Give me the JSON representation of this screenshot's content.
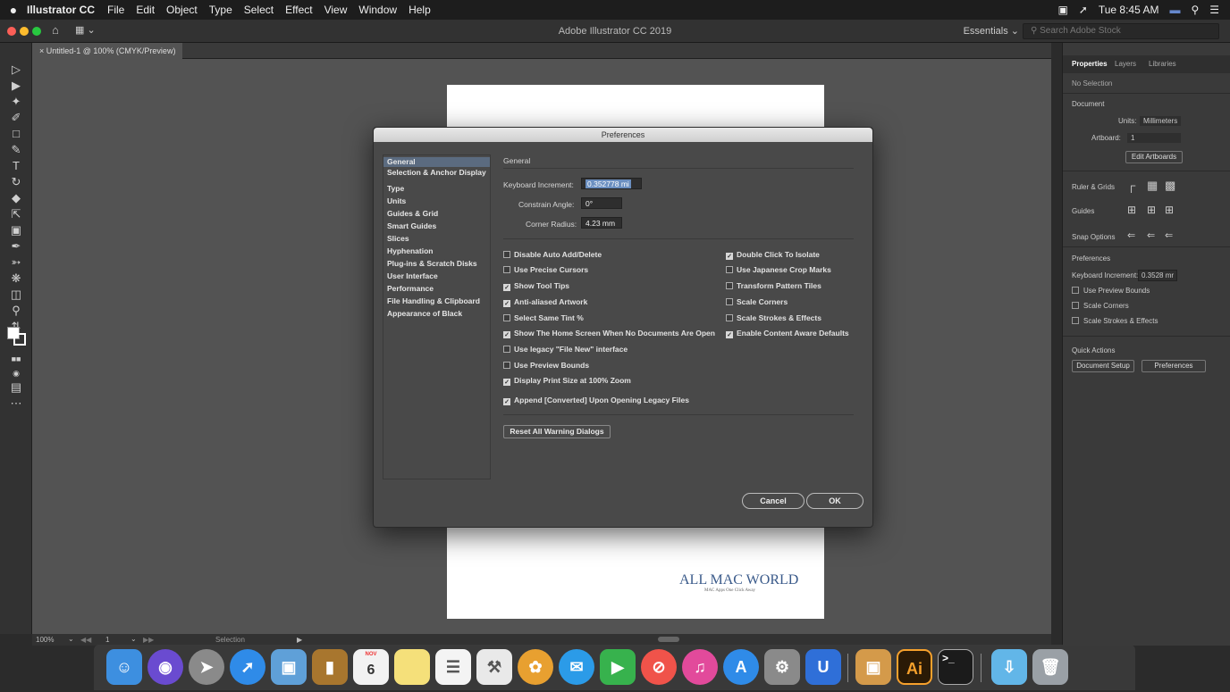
{
  "menubar": {
    "apple": "",
    "app_name": "Illustrator CC",
    "menus": [
      "File",
      "Edit",
      "Object",
      "Type",
      "Select",
      "Effect",
      "View",
      "Window",
      "Help"
    ],
    "clock": "Tue 8:45 AM"
  },
  "titlebar": {
    "title": "Adobe Illustrator CC 2019",
    "workspace": "Essentials ⌄",
    "search_placeholder": "Search Adobe Stock"
  },
  "document": {
    "tab_label": "× Untitled-1 @ 100% (CMYK/Preview)"
  },
  "statusbar": {
    "zoom": "100%",
    "artboard": "1",
    "tool": "Selection"
  },
  "watermark": {
    "title": "ALL MAC WORLD",
    "subtitle": "MAC Apps One Click Away"
  },
  "properties": {
    "tabs": [
      "Properties",
      "Layers",
      "Libraries"
    ],
    "no_selection": "No Selection",
    "document_heading": "Document",
    "units_label": "Units:",
    "units_value": "Millimeters",
    "artboard_label": "Artboard:",
    "artboard_value": "1",
    "edit_artboards": "Edit Artboards",
    "ruler_grids": "Ruler & Grids",
    "guides": "Guides",
    "snap_options": "Snap Options",
    "preferences_heading": "Preferences",
    "keyboard_increment_label": "Keyboard Increment:",
    "keyboard_increment_value": "0.3528 mr",
    "use_preview_bounds": "Use Preview Bounds",
    "scale_corners": "Scale Corners",
    "scale_strokes": "Scale Strokes & Effects",
    "quick_actions": "Quick Actions",
    "document_setup": "Document Setup",
    "preferences_button": "Preferences"
  },
  "dialog": {
    "title": "Preferences",
    "categories": [
      "General",
      "Selection & Anchor Display",
      "Type",
      "Units",
      "Guides & Grid",
      "Smart Guides",
      "Slices",
      "Hyphenation",
      "Plug-ins & Scratch Disks",
      "User Interface",
      "Performance",
      "File Handling & Clipboard",
      "Appearance of Black"
    ],
    "section_title": "General",
    "keyboard_increment_label": "Keyboard Increment:",
    "keyboard_increment_value": "0.352778 mi",
    "constrain_angle_label": "Constrain Angle:",
    "constrain_angle_value": "0°",
    "corner_radius_label": "Corner Radius:",
    "corner_radius_value": "4.23 mm",
    "left_options": [
      {
        "label": "Disable Auto Add/Delete",
        "checked": false
      },
      {
        "label": "Use Precise Cursors",
        "checked": false
      },
      {
        "label": "Show Tool Tips",
        "checked": true
      },
      {
        "label": "Anti-aliased Artwork",
        "checked": true
      },
      {
        "label": "Select Same Tint %",
        "checked": false
      },
      {
        "label": "Show The Home Screen When No Documents Are Open",
        "checked": true
      },
      {
        "label": "Use legacy \"File New\" interface",
        "checked": false
      },
      {
        "label": "Use Preview Bounds",
        "checked": false
      },
      {
        "label": "Display Print Size at 100% Zoom",
        "checked": true
      },
      {
        "label": "Append [Converted] Upon Opening Legacy Files",
        "checked": true
      }
    ],
    "right_options": [
      {
        "label": "Double Click To Isolate",
        "checked": true
      },
      {
        "label": "Use Japanese Crop Marks",
        "checked": false
      },
      {
        "label": "Transform Pattern Tiles",
        "checked": false
      },
      {
        "label": "Scale Corners",
        "checked": false
      },
      {
        "label": "Scale Strokes & Effects",
        "checked": false
      },
      {
        "label": "Enable Content Aware Defaults",
        "checked": true
      }
    ],
    "reset_button": "Reset All Warning Dialogs",
    "cancel_button": "Cancel",
    "ok_button": "OK"
  },
  "dock": {
    "apps": [
      "finder-icon",
      "siri-icon",
      "launchpad-icon",
      "safari-icon",
      "preview-icon",
      "notes-book-icon",
      "calendar-icon",
      "notes-icon",
      "reminders-icon",
      "tools-icon",
      "photos-icon",
      "messages-icon",
      "facetime-icon",
      "news-icon",
      "itunes-icon",
      "app-store-icon",
      "system-preferences-icon",
      "magnet-icon",
      "image-icon",
      "illustrator-icon",
      "terminal-icon",
      "downloads-icon",
      "trash-icon"
    ],
    "calendar_month": "NOV",
    "calendar_day": "6",
    "illustrator_label": "Ai",
    "terminal_label": ">_"
  },
  "colors": {
    "accent": "#5b6b80",
    "dialog_bg": "#494949",
    "canvas_bg": "#535353"
  }
}
